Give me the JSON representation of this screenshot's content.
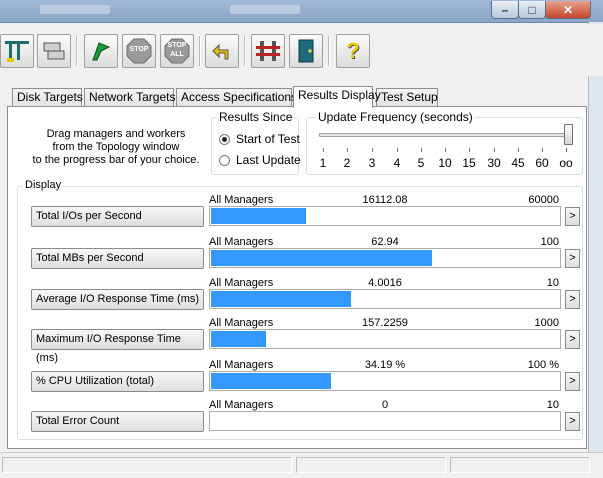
{
  "toolbar": {
    "icons": [
      "topology-icon",
      "disk-workers-icon",
      "start-flag-icon",
      "stop-icon",
      "stop-all-icon",
      "reset-icon",
      "new-worker-icon",
      "exit-icon",
      "help-icon"
    ],
    "stop_text": "STOP",
    "stop_all_text_1": "STOP",
    "stop_all_text_2": "ALL",
    "help_text": "?"
  },
  "tabs": [
    {
      "label": "Disk Targets"
    },
    {
      "label": "Network Targets"
    },
    {
      "label": "Access Specifications"
    },
    {
      "label": "Results Display"
    },
    {
      "label": "Test Setup"
    }
  ],
  "hint": {
    "line1": "Drag managers and workers",
    "line2": "from the Topology window",
    "line3": "to the progress bar of your choice."
  },
  "results_since": {
    "title": "Results Since",
    "options": [
      "Start of Test",
      "Last Update"
    ],
    "selected": "Start of Test"
  },
  "update_frequency": {
    "title": "Update Frequency (seconds)",
    "ticks": [
      "1",
      "2",
      "3",
      "4",
      "5",
      "10",
      "15",
      "30",
      "45",
      "60",
      "oo"
    ],
    "selected": "oo"
  },
  "display": {
    "title": "Display",
    "metrics": [
      {
        "label": "Total I/Os per Second",
        "source": "All Managers",
        "value": "16112.08",
        "max": "60000",
        "fraction": 0.27
      },
      {
        "label": "Total MBs per Second",
        "source": "All Managers",
        "value": "62.94",
        "max": "100",
        "fraction": 0.63
      },
      {
        "label": "Average I/O Response Time (ms)",
        "source": "All Managers",
        "value": "4.0016",
        "max": "10",
        "fraction": 0.4
      },
      {
        "label": "Maximum I/O Response Time (ms)",
        "source": "All Managers",
        "value": "157.2259",
        "max": "1000",
        "fraction": 0.157
      },
      {
        "label": "% CPU Utilization (total)",
        "source": "All Managers",
        "value": "34.19 %",
        "max": "100 %",
        "fraction": 0.342
      },
      {
        "label": "Total Error Count",
        "source": "All Managers",
        "value": "0",
        "max": "10",
        "fraction": 0
      }
    ],
    "arrow_label": ">"
  },
  "window": {
    "minimize": "–",
    "maximize": "□",
    "close": "✕"
  }
}
